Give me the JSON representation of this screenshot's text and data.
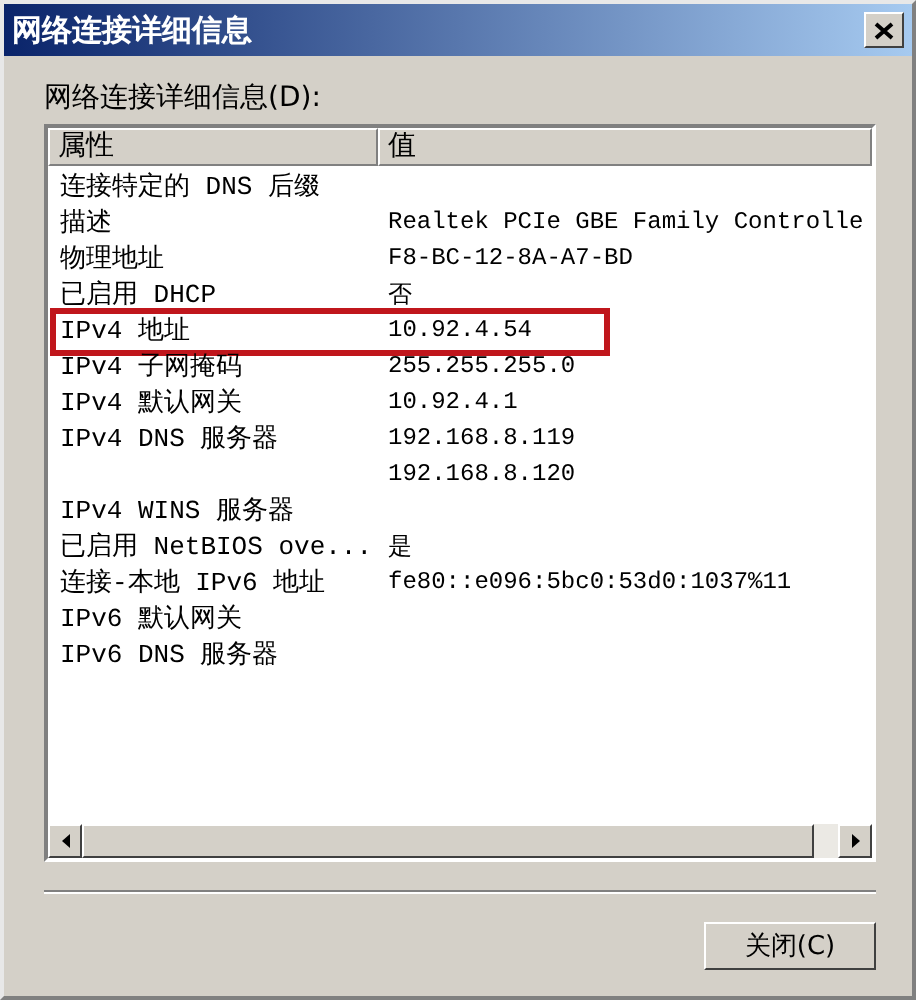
{
  "window": {
    "title": "网络连接详细信息"
  },
  "list_label": "网络连接详细信息(D):",
  "table": {
    "columns": [
      "属性",
      "值"
    ],
    "rows": [
      {
        "property": "连接特定的 DNS 后缀",
        "value": "",
        "highlighted": false
      },
      {
        "property": "描述",
        "value": "Realtek PCIe GBE Family Controlle",
        "highlighted": false
      },
      {
        "property": "物理地址",
        "value": "F8-BC-12-8A-A7-BD",
        "highlighted": false
      },
      {
        "property": "已启用 DHCP",
        "value": "否",
        "highlighted": false
      },
      {
        "property": "IPv4 地址",
        "value": "10.92.4.54",
        "highlighted": true
      },
      {
        "property": "IPv4 子网掩码",
        "value": "255.255.255.0",
        "highlighted": false
      },
      {
        "property": "IPv4 默认网关",
        "value": "10.92.4.1",
        "highlighted": false
      },
      {
        "property": "IPv4 DNS 服务器",
        "value": "192.168.8.119",
        "highlighted": false
      },
      {
        "property": "",
        "value": "192.168.8.120",
        "highlighted": false
      },
      {
        "property": "IPv4 WINS 服务器",
        "value": "",
        "highlighted": false
      },
      {
        "property": "已启用 NetBIOS ove...",
        "value": "是",
        "highlighted": false
      },
      {
        "property": "连接-本地 IPv6 地址",
        "value": "fe80::e096:5bc0:53d0:1037%11",
        "highlighted": false
      },
      {
        "property": "IPv6 默认网关",
        "value": "",
        "highlighted": false
      },
      {
        "property": "IPv6 DNS 服务器",
        "value": "",
        "highlighted": false
      }
    ]
  },
  "buttons": [
    "关闭(C)"
  ]
}
